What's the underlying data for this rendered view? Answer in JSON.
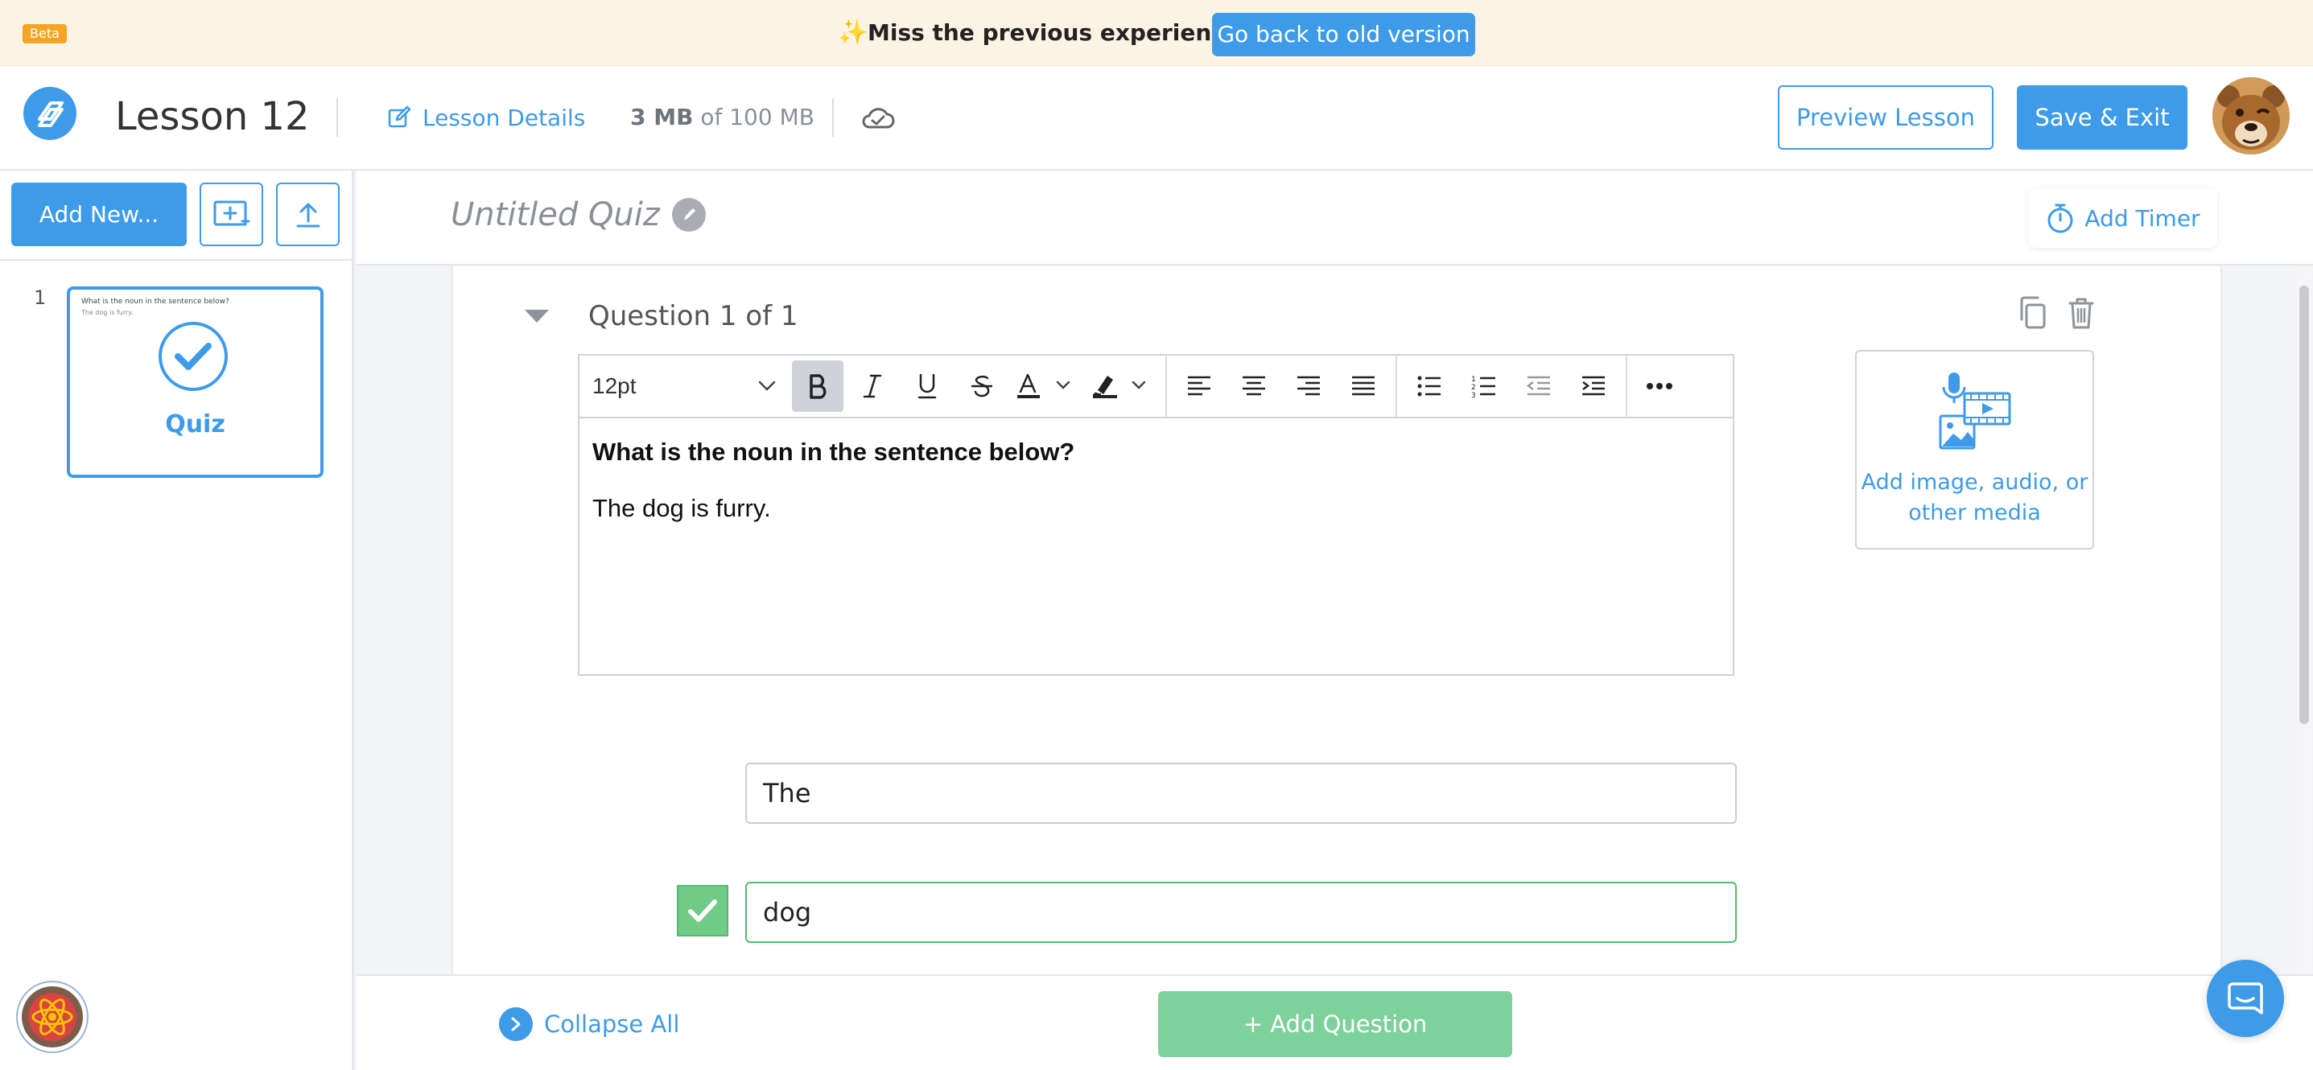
{
  "banner": {
    "badge": "Beta",
    "sparkle": "✨",
    "message": "Miss the previous experience?",
    "button": "Go back to old version"
  },
  "header": {
    "title": "Lesson 12",
    "details_link": "Lesson Details",
    "storage_used": "3 MB",
    "storage_of": "of 100 MB",
    "preview_button": "Preview Lesson",
    "save_button": "Save & Exit"
  },
  "sidebar": {
    "add_new": "Add New...",
    "slides": [
      {
        "number": "1",
        "title": "What is the noun in the sentence below?",
        "subtitle": "The dog is furry.",
        "label": "Quiz"
      }
    ]
  },
  "quiz": {
    "title": "Untitled Quiz",
    "add_timer": "Add Timer"
  },
  "question": {
    "label": "Question 1 of 1",
    "font_size": "12pt",
    "text_bold": "What is the noun in the sentence below?",
    "text_body": "The dog is furry.",
    "media_label": "Add image, audio, or other media",
    "answers": [
      {
        "text": "The",
        "correct": false
      },
      {
        "text": "dog",
        "correct": true
      }
    ]
  },
  "footer": {
    "collapse_all": "Collapse All",
    "add_question": "+ Add Question"
  },
  "colors": {
    "accent": "#3d9be9",
    "banner_bg": "#fcf3e4",
    "correct": "#6fcb85",
    "beta": "#f5a524"
  }
}
